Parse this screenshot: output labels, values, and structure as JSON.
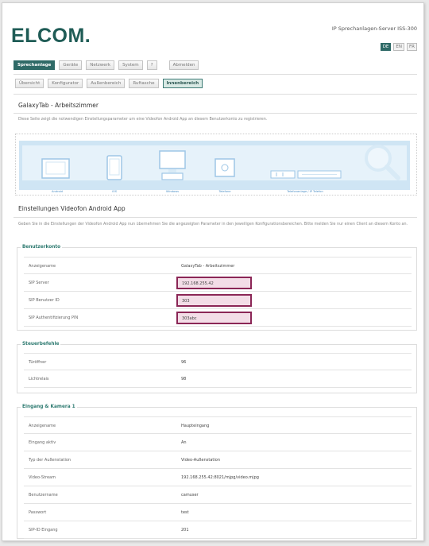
{
  "header": {
    "logo": "ELCOM.",
    "server_title": "IP Sprechanlagen-Server ISS-300",
    "languages": [
      {
        "label": "DE",
        "active": true
      },
      {
        "label": "EN",
        "active": false
      },
      {
        "label": "FR",
        "active": false
      }
    ]
  },
  "nav_main": [
    {
      "label": "Sprechanlage",
      "active": true
    },
    {
      "label": "Geräte",
      "active": false
    },
    {
      "label": "Netzwerk",
      "active": false
    },
    {
      "label": "System",
      "active": false
    },
    {
      "label": "?",
      "active": false
    },
    {
      "label": "Abmelden",
      "active": false
    }
  ],
  "nav_sub": [
    {
      "label": "Übersicht",
      "active": false
    },
    {
      "label": "Konfigurator",
      "active": false
    },
    {
      "label": "Außenbereich",
      "active": false
    },
    {
      "label": "Ruftasche",
      "active": false
    },
    {
      "label": "Innenbereich",
      "active": true
    }
  ],
  "page": {
    "title": "GalaxyTab - Arbeitszimmer",
    "description": "Diese Seite zeigt die notwendigen Einstellungsparameter um eine Videofon Android App an diesem Benutzerkonto zu registrieren."
  },
  "diagram": {
    "labels": [
      "Android",
      "iOS",
      "Windows",
      "Telefone",
      "Telefonanlage / IP Telefon"
    ]
  },
  "settings": {
    "title": "Einstellungen Videofon Android App",
    "description": "Geben Sie in die Einstellungen der Videofon Android App nun übernehmen Sie die angezeigten Parameter in den jeweiligen Konfigurationsbereichen. Bitte melden Sie nur einen Client an diesem Konto an."
  },
  "sections": [
    {
      "title": "Benutzerkonto",
      "rows": [
        {
          "label": "Anzeigename",
          "value": "GalaxyTab - Arbeitszimmer",
          "highlight": false
        },
        {
          "label": "SIP Server",
          "value": "192.168.255.42",
          "highlight": true
        },
        {
          "label": "SIP Benutzer ID",
          "value": "303",
          "highlight": true
        },
        {
          "label": "SIP Authentifizierung PIN",
          "value": "303abc",
          "highlight": true
        }
      ]
    },
    {
      "title": "Steuerbefehle",
      "rows": [
        {
          "label": "Türöffner",
          "value": "96",
          "highlight": false
        },
        {
          "label": "Lichtrelais",
          "value": "98",
          "highlight": false
        }
      ]
    },
    {
      "title": "Eingang & Kamera 1",
      "rows": [
        {
          "label": "Anzeigename",
          "value": "Haupteingang",
          "highlight": false
        },
        {
          "label": "Eingang aktiv",
          "value": "An",
          "highlight": false
        },
        {
          "label": "Typ der Außenstation",
          "value": "Video-Außenstation",
          "highlight": false
        },
        {
          "label": "Video-Stream",
          "value": "192.168.255.42:8021/mjpg/video.mjpg",
          "highlight": false
        },
        {
          "label": "Benutzername",
          "value": "camuser",
          "highlight": false
        },
        {
          "label": "Passwort",
          "value": "test",
          "highlight": false
        },
        {
          "label": "SIP-ID Eingang",
          "value": "201",
          "highlight": false
        }
      ]
    }
  ]
}
